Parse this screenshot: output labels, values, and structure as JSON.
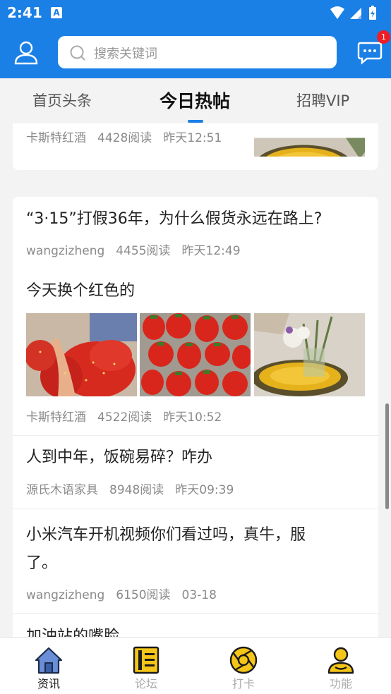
{
  "status_bar": {
    "time": "2:41",
    "notification_icon": "a-icon"
  },
  "header": {
    "search_placeholder": "搜索关键词",
    "message_badge": "1"
  },
  "tabs": [
    {
      "label": "首页头条",
      "active": false
    },
    {
      "label": "今日热帖",
      "active": true
    },
    {
      "label": "招聘VIP",
      "active": false
    }
  ],
  "feed": {
    "partial_post": {
      "author": "卡斯特红酒",
      "reads": "4428阅读",
      "time": "昨天12:51"
    },
    "posts": [
      {
        "title": "“3·15”打假36年，为什么假货永远在路上?",
        "author": "wangzizheng",
        "reads": "4455阅读",
        "time": "昨天12:49"
      },
      {
        "title": "今天换个红色的",
        "author": "卡斯特红酒",
        "reads": "4522阅读",
        "time": "昨天10:52",
        "images": [
          "strawberries-hand",
          "strawberries-box",
          "flowers-vase"
        ]
      },
      {
        "title": "人到中年，饭碗易碎？咋办",
        "author": "源氏木语家具",
        "reads": "8948阅读",
        "time": "昨天09:39"
      },
      {
        "title_line1": "小米汽车开机视频你们看过吗，真牛，服",
        "title_line2": "了。",
        "author": "wangzizheng",
        "reads": "6150阅读",
        "time": "03-18"
      },
      {
        "title": "加油站的嘴脸"
      }
    ]
  },
  "bottom_nav": [
    {
      "label": "资讯",
      "icon": "home-icon",
      "active": true
    },
    {
      "label": "论坛",
      "icon": "forum-icon",
      "active": false
    },
    {
      "label": "打卡",
      "icon": "checkin-icon",
      "active": false
    },
    {
      "label": "功能",
      "icon": "user-function-icon",
      "active": false
    }
  ],
  "colors": {
    "brand": "#1a80e6",
    "badge": "#ee1c25",
    "nav_accent": "#f5c518"
  }
}
